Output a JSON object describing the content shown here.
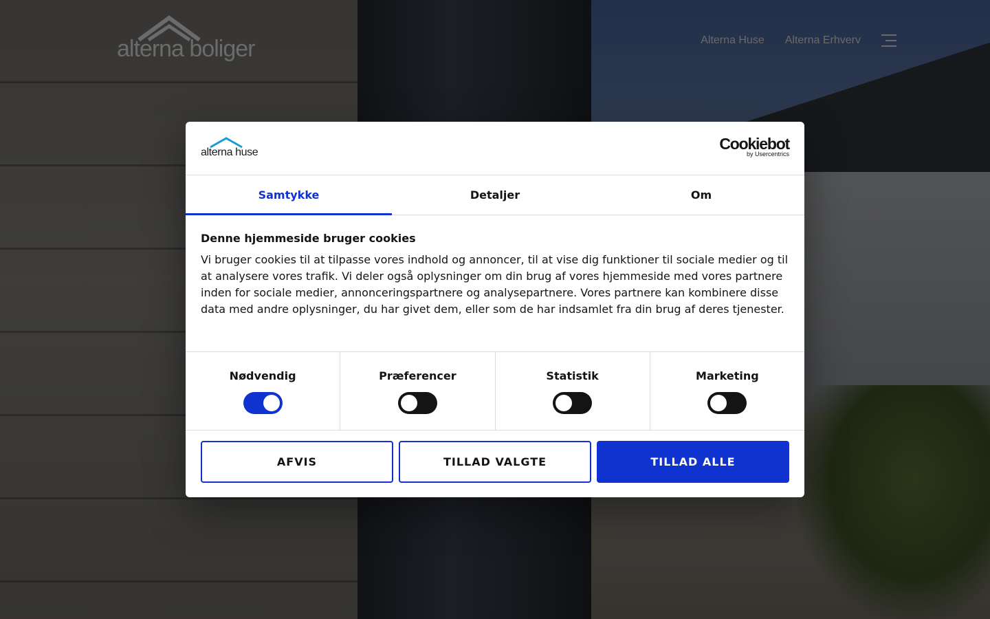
{
  "site": {
    "logo_text": "alterna boliger",
    "nav": [
      "Alterna Huse",
      "Alterna Erhverv"
    ]
  },
  "dialog": {
    "brand_logo_text": "alterna huse",
    "cookiebot_name": "Cookiebot",
    "cookiebot_sub": "by Usercentrics",
    "tabs": [
      {
        "label": "Samtykke",
        "active": true
      },
      {
        "label": "Detaljer",
        "active": false
      },
      {
        "label": "Om",
        "active": false
      }
    ],
    "heading": "Denne hjemmeside bruger cookies",
    "body": "Vi bruger cookies til at tilpasse vores indhold og annoncer, til at vise dig funktioner til sociale medier og til at analysere vores trafik. Vi deler også oplysninger om din brug af vores hjemmeside med vores partnere inden for sociale medier, annonceringspartnere og analysepartnere. Vores partnere kan kombinere disse data med andre oplysninger, du har givet dem, eller som de har indsamlet fra din brug af deres tjenester.",
    "toggles": [
      {
        "label": "Nødvendig",
        "on": true
      },
      {
        "label": "Præferencer",
        "on": false
      },
      {
        "label": "Statistik",
        "on": false
      },
      {
        "label": "Marketing",
        "on": false
      }
    ],
    "buttons": {
      "reject": "AFVIS",
      "allow_selected": "TILLAD VALGTE",
      "allow_all": "TILLAD ALLE"
    }
  },
  "colors": {
    "accent": "#1032cf",
    "logo_roof": "#1a9ad6"
  }
}
